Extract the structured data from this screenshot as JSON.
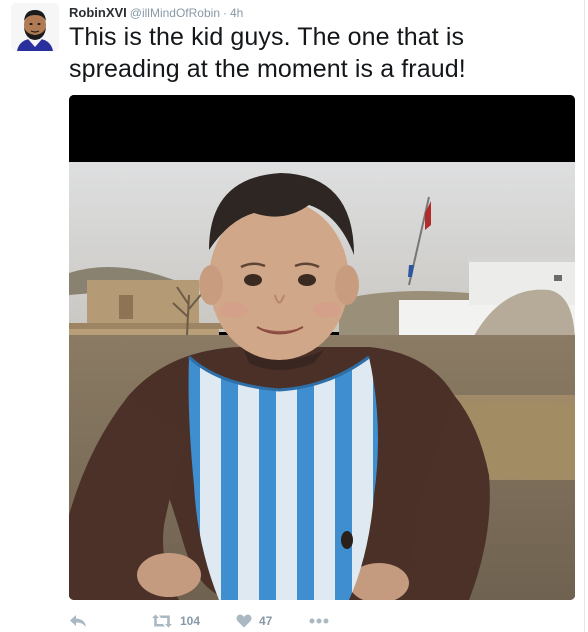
{
  "tweet": {
    "author": {
      "display_name": "RobinXVI",
      "handle": "@illMindOfRobin",
      "separator": "·",
      "timestamp": "4h"
    },
    "text_lines": [
      "This is the kid guys. The one that is",
      "spreading at the moment is a fraud!"
    ],
    "media": {
      "icon": "photo"
    },
    "actions": {
      "reply_icon": "reply-arrow",
      "retweet_icon": "retweet-arrows",
      "retweet_count": "104",
      "like_icon": "heart",
      "like_count": "47",
      "more_icon": "ellipsis"
    }
  },
  "colors": {
    "text": "#14171a",
    "muted": "#8899a6",
    "icon": "#aab8c2",
    "border": "#e1e8ed"
  }
}
